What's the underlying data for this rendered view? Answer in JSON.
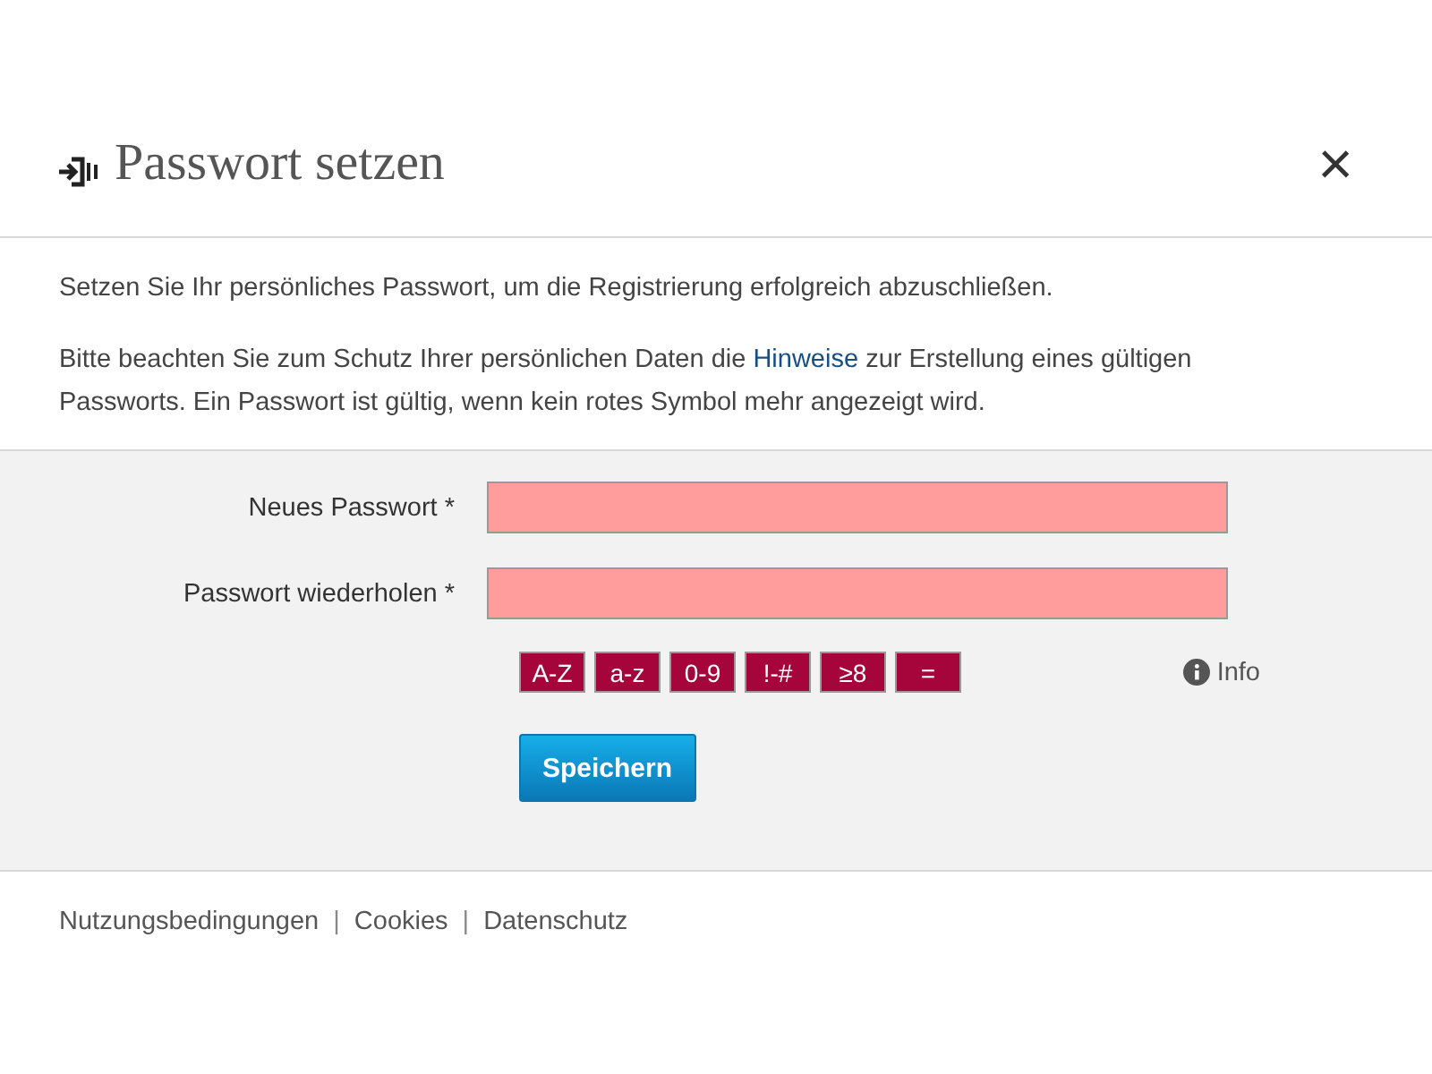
{
  "dialog": {
    "title": "Passwort setzen",
    "close": "×"
  },
  "intro": "Setzen Sie Ihr persönliches Passwort, um die Registrierung erfolgreich abzuschließen.",
  "note": {
    "before": "Bitte beachten Sie zum Schutz Ihrer persönlichen Daten die",
    "link": "Hinweise",
    "after": "zur Erstellung eines gültigen Passworts. Ein Passwort ist gültig, wenn kein rotes Symbol mehr angezeigt wird."
  },
  "fields": [
    {
      "label": "Neues Passwort *",
      "invalid": true
    },
    {
      "label": "Passwort wiederholen *",
      "invalid": true
    }
  ],
  "rules": [
    {
      "label": "A-Z",
      "fulfilled": false
    },
    {
      "label": "a-z",
      "fulfilled": false
    },
    {
      "label": "0-9",
      "fulfilled": false
    },
    {
      "label": "!-#",
      "fulfilled": false
    },
    {
      "label": "≥8",
      "fulfilled": false
    },
    {
      "label": "=",
      "fulfilled": false
    }
  ],
  "info": "Info",
  "save_button": "Speichern",
  "footer": [
    {
      "kind": "link",
      "text": "Nutzungsbedingungen"
    },
    {
      "kind": "separator",
      "text": "|"
    },
    {
      "kind": "link",
      "text": "Cookies"
    },
    {
      "kind": "separator",
      "text": "|"
    },
    {
      "kind": "link",
      "text": "Datenschutz"
    }
  ]
}
